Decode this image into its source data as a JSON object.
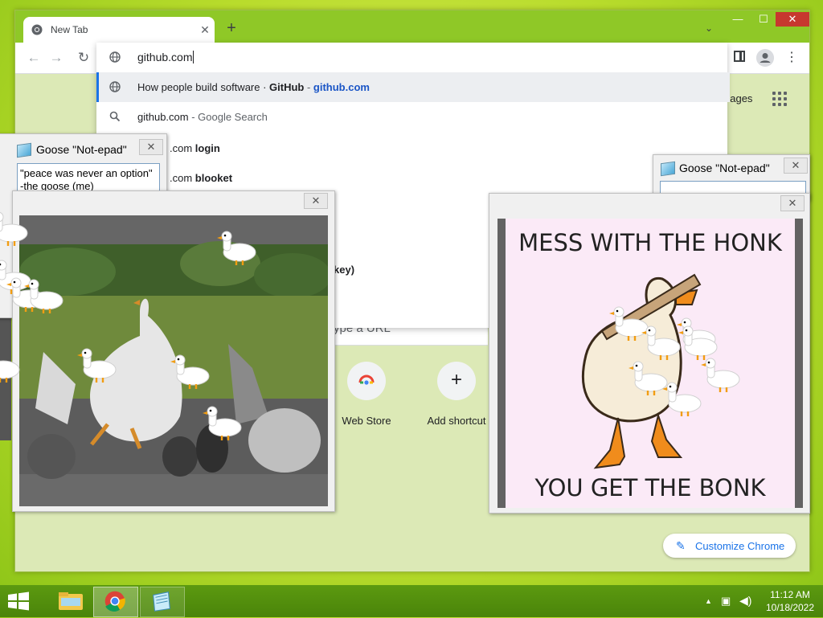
{
  "browser": {
    "tab_title": "New Tab",
    "new_tab": "+",
    "tab_search": "⌄",
    "window": {
      "minimize": "—",
      "maximize": "☐",
      "close": "✕"
    },
    "nav": {
      "back": "←",
      "forward": "→",
      "reload": "↻",
      "menu": "⋮"
    }
  },
  "omnibox": {
    "value": "github.com",
    "suggestions": [
      {
        "icon": "globe-icon",
        "title": "How people build software · ",
        "title_bold": "GitHub",
        "separator": " - ",
        "url": "github.com"
      },
      {
        "icon": "search-icon",
        "text": "github.com",
        "suffix": " - Google Search"
      },
      {
        "partial_prefix": ".com ",
        "partial_bold": "login"
      },
      {
        "partial_prefix": ".com ",
        "partial_bold": "blooket"
      },
      {
        "partial_bold": "key)"
      }
    ]
  },
  "ntp": {
    "images_partial": "nages",
    "search_placeholder_partial": "ype a URL",
    "shortcuts": [
      {
        "label": "Web Store",
        "icon": "web-store-icon"
      },
      {
        "label": "Add shortcut",
        "icon": "plus-icon",
        "glyph": "+"
      }
    ],
    "customize_label": "Customize Chrome",
    "customize_icon": "✎"
  },
  "goose_notes": [
    {
      "title": "Goose \"Not-epad\"",
      "lines": [
        "\"peace was never an option\"",
        " -the goose (me)"
      ],
      "close": "✕"
    },
    {
      "title": "Goose \"Not-epad\"",
      "lines": [],
      "close": "✕"
    }
  ],
  "goose_images": [
    {
      "close": "✕",
      "description": "photo-of-geese"
    },
    {
      "close": "✕",
      "top_text": "MESS WITH THE HONK",
      "bottom_text": "YOU GET THE BONK"
    }
  ],
  "taskbar": {
    "apps": [
      "file-explorer-icon",
      "chrome-icon",
      "notepad-icon"
    ],
    "tray": {
      "up_arrow": "▲",
      "network": "▣",
      "volume": "◀)"
    },
    "time": "11:12 AM",
    "date": "10/18/2022"
  },
  "colors": {
    "desktop": "#b9dc2c",
    "tab_strip": "#8fc827",
    "taskbar": "#4f8c0c",
    "accent_blue": "#1a73e8",
    "close_red": "#c7382f"
  }
}
